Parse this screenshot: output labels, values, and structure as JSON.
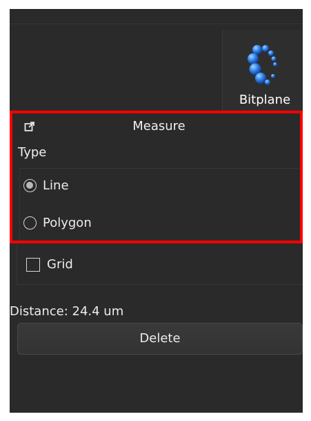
{
  "logo": {
    "text": "Bitplane",
    "icon": "bitplane-logo"
  },
  "measure": {
    "title": "Measure",
    "popout_icon": "popout-icon",
    "type_label": "Type",
    "options": [
      {
        "label": "Line",
        "checked": true
      },
      {
        "label": "Polygon",
        "checked": false
      }
    ]
  },
  "grid": {
    "label": "Grid",
    "checked": false
  },
  "distance_text": "Distance: 24.4 um",
  "delete_label": "Delete",
  "colors": {
    "highlight": "#ff0000",
    "background": "#2b2a2a",
    "text": "#e6e6e6"
  }
}
